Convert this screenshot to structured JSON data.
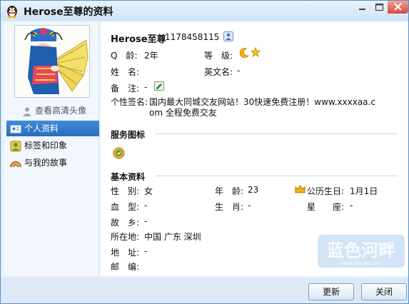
{
  "window": {
    "title": "Herose至尊的资料"
  },
  "left_panel": {
    "view_hd_avatar": "查看高清头像",
    "nav": [
      "个人资料",
      "标签和印象",
      "与我的故事"
    ]
  },
  "profile": {
    "nickname": "Herose至尊",
    "qq_number": "1178458115",
    "q_age_label": "Q　龄:",
    "q_age_value": "2年",
    "level_label": "等　级:",
    "name_label": "姓　名:",
    "english_name_label": "英文名:",
    "english_name_value": "-",
    "remark_label": "备　注:",
    "remark_value": "-",
    "signature_label": "个性签名:",
    "signature_line1": "国内最大同城交友网站！30快速免费注册！www.xxxxaa.c",
    "signature_line2": "om 全程免费交友"
  },
  "service": {
    "section_title": "服务图标"
  },
  "basic": {
    "section_title": "基本资料",
    "gender_label": "性　别:",
    "gender_value": "女",
    "age_label": "年　龄:",
    "age_value": "23",
    "birthday_label": "公历生日:",
    "birthday_value": "1月1日",
    "blood_label": "血　型:",
    "blood_value": "-",
    "zodiac_label": "生　肖:",
    "zodiac_value": "-",
    "constellation_label": "星　　座:",
    "constellation_value": "-",
    "hometown_label": "故　乡:",
    "hometown_value": "-",
    "location_label": "所在地:",
    "location_value": "中国 广东 深圳",
    "address_label": "地　址:",
    "address_value": "-",
    "postcode_label": "邮　编:"
  },
  "buttons": {
    "update": "更新",
    "close": "关闭"
  },
  "watermark": {
    "text": "蓝色河畔",
    "sub": "www.lsqpan.com"
  },
  "colors": {
    "accent": "#2a6cbd",
    "window_border": "#5c8fbf",
    "close_red": "#d6473b"
  }
}
